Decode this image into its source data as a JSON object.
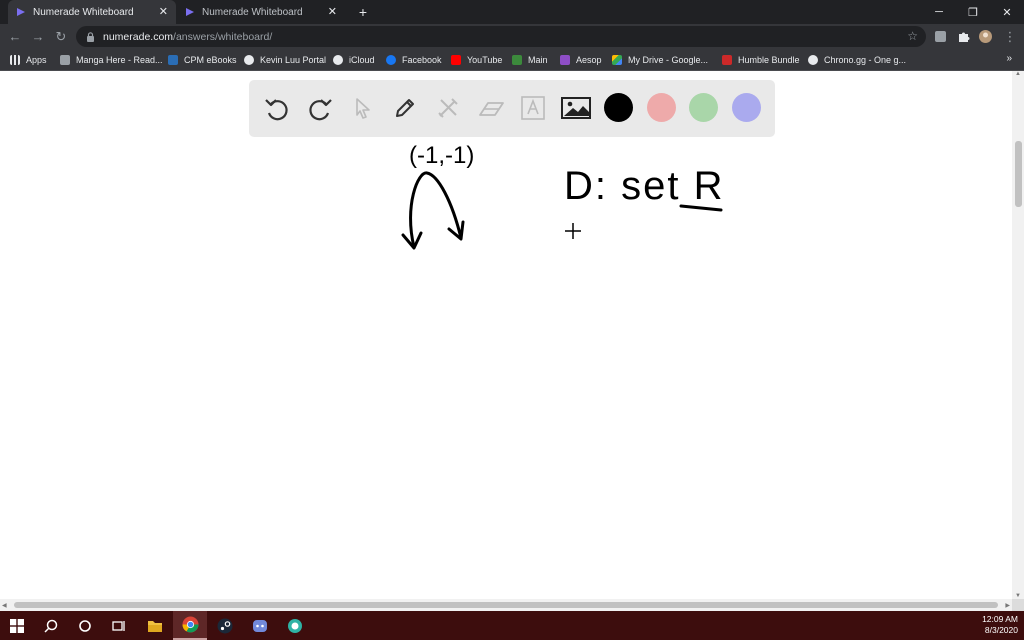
{
  "browser": {
    "tabs": [
      {
        "title": "Numerade Whiteboard",
        "active": true
      },
      {
        "title": "Numerade Whiteboard",
        "active": false
      }
    ],
    "url_host": "numerade.com",
    "url_path": "/answers/whiteboard/",
    "bookmarks": [
      {
        "label": "Apps",
        "icon": "apps-grid-icon",
        "color": "#e8eaed"
      },
      {
        "label": "Manga Here - Read...",
        "icon": "manga-here-icon",
        "color": "#e8eaed"
      },
      {
        "label": "CPM eBooks",
        "icon": "cpm-icon",
        "color": "#2a6db5"
      },
      {
        "label": "Kevin Luu Portal",
        "icon": "portal-icon",
        "color": "#e8eaed"
      },
      {
        "label": "iCloud",
        "icon": "apple-icon",
        "color": "#e8eaed"
      },
      {
        "label": "Facebook",
        "icon": "facebook-icon",
        "color": "#1877f2"
      },
      {
        "label": "YouTube",
        "icon": "youtube-icon",
        "color": "#ff0000"
      },
      {
        "label": "Main",
        "icon": "main-icon",
        "color": "#3c8a3c"
      },
      {
        "label": "Aesop",
        "icon": "aesop-icon",
        "color": "#8e4ec6"
      },
      {
        "label": "My Drive - Google...",
        "icon": "google-drive-icon",
        "color": "#fbbc04"
      },
      {
        "label": "Humble Bundle",
        "icon": "humble-icon",
        "color": "#cc2929"
      },
      {
        "label": "Chrono.gg - One g...",
        "icon": "chrono-icon",
        "color": "#e8eaed"
      }
    ],
    "bookmarks_more": "»"
  },
  "whiteboard": {
    "tools": [
      {
        "name": "undo-icon"
      },
      {
        "name": "redo-icon"
      },
      {
        "name": "select-pointer-icon"
      },
      {
        "name": "pen-icon"
      },
      {
        "name": "tools-icon"
      },
      {
        "name": "eraser-icon"
      },
      {
        "name": "text-icon"
      },
      {
        "name": "image-icon"
      }
    ],
    "colors": [
      "#000000",
      "#eeaaaa",
      "#a9d6a9",
      "#aaaaee"
    ],
    "canvas": {
      "point_label": "(-1,-1)",
      "domain_text": "D: set R"
    }
  },
  "taskbar": {
    "items": [
      "windows-start-icon",
      "search-icon",
      "cortana-icon",
      "task-view-icon",
      "file-explorer-icon",
      "chrome-icon",
      "steam-icon",
      "discord-icon",
      "app-icon"
    ],
    "time": "12:09 AM",
    "date": "8/3/2020"
  }
}
